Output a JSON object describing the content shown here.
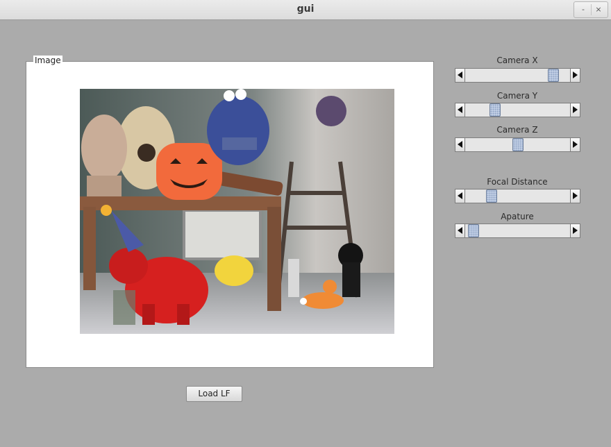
{
  "window": {
    "title": "gui",
    "minimize_glyph": "-",
    "close_glyph": "×"
  },
  "image_panel": {
    "legend": "Image"
  },
  "sliders": [
    {
      "label": "Camera X",
      "level": 0.88
    },
    {
      "label": "Camera Y",
      "level": 0.26
    },
    {
      "label": "Camera Z",
      "level": 0.5
    },
    {
      "label": "Focal Distance",
      "level": 0.22
    },
    {
      "label": "Apature",
      "level": 0.03
    }
  ],
  "buttons": {
    "load_label": "Load LF"
  }
}
